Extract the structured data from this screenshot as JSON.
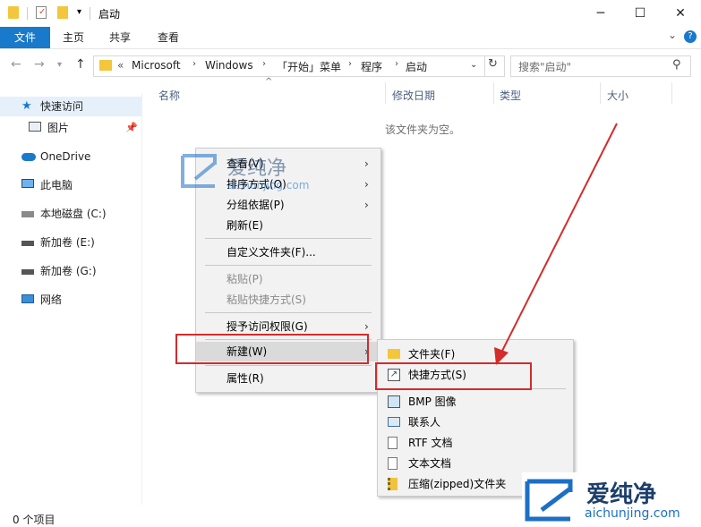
{
  "window": {
    "title": "启动",
    "controls": {
      "minimize": "─",
      "maximize": "☐",
      "close": "✕"
    }
  },
  "ribbon": {
    "tabs": [
      "文件",
      "主页",
      "共享",
      "查看"
    ],
    "expand": "⌄",
    "help": "?"
  },
  "address": {
    "crumbs": [
      "«",
      "Microsoft",
      "Windows",
      "「开始」菜单",
      "程序",
      "启动"
    ],
    "search_placeholder": "搜索\"启动\""
  },
  "columns": {
    "name": "名称",
    "modified": "修改日期",
    "type": "类型",
    "size": "大小"
  },
  "sidebar": {
    "items": [
      {
        "label": "快速访问",
        "icon": "star-icon"
      },
      {
        "label": "图片",
        "icon": "pictures-icon"
      },
      {
        "label": "OneDrive",
        "icon": "cloud-icon"
      },
      {
        "label": "此电脑",
        "icon": "computer-icon"
      },
      {
        "label": "本地磁盘 (C:)",
        "icon": "drive-icon"
      },
      {
        "label": "新加卷 (E:)",
        "icon": "drive-icon"
      },
      {
        "label": "新加卷 (G:)",
        "icon": "drive-icon"
      },
      {
        "label": "网络",
        "icon": "network-icon"
      }
    ]
  },
  "content": {
    "empty_message": "该文件夹为空。"
  },
  "status": {
    "item_count": "0 个项目"
  },
  "context_menu": {
    "items": [
      {
        "label": "查看(V)"
      },
      {
        "label": "排序方式(O)"
      },
      {
        "label": "分组依据(P)"
      },
      {
        "label": "刷新(E)"
      },
      {
        "label": "自定义文件夹(F)..."
      },
      {
        "label": "粘贴(P)"
      },
      {
        "label": "粘贴快捷方式(S)"
      },
      {
        "label": "授予访问权限(G)"
      },
      {
        "label": "新建(W)"
      },
      {
        "label": "属性(R)"
      }
    ]
  },
  "submenu": {
    "items": [
      {
        "label": "文件夹(F)",
        "icon": "folder-icon"
      },
      {
        "label": "快捷方式(S)",
        "icon": "shortcut-icon"
      },
      {
        "label": "BMP 图像",
        "icon": "bmp-icon"
      },
      {
        "label": "联系人",
        "icon": "contact-icon"
      },
      {
        "label": "RTF 文档",
        "icon": "rtf-icon"
      },
      {
        "label": "文本文档",
        "icon": "text-doc-icon"
      },
      {
        "label": "压缩(zipped)文件夹",
        "icon": "zip-folder-icon"
      }
    ]
  },
  "watermark": {
    "brand": "爱纯净",
    "url": "aichunjing.com"
  },
  "colors": {
    "accent": "#1979ca",
    "annotation_red": "#d42b2b"
  }
}
